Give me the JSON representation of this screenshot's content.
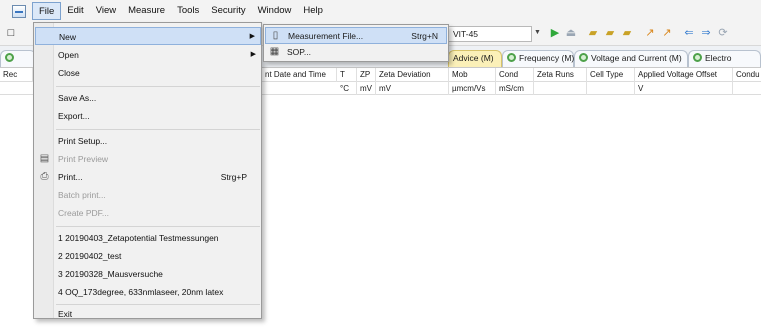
{
  "menubar": {
    "items": [
      "File",
      "Edit",
      "View",
      "Measure",
      "Tools",
      "Security",
      "Window",
      "Help"
    ]
  },
  "toolbar": {
    "instrument_combo": "VIT-45"
  },
  "tabs": [
    {
      "label": "Advice (M)",
      "icon": "advice-icon"
    },
    {
      "label": "Frequency (M)",
      "icon": "frequency-icon"
    },
    {
      "label": "Voltage and Current (M)",
      "icon": "voltage-icon"
    },
    {
      "label": "Electro",
      "icon": "electro-icon"
    }
  ],
  "table": {
    "first_col": "Rec",
    "headers": [
      "nt Date and Time",
      "T",
      "ZP",
      "Zeta Deviation",
      "Mob",
      "Cond",
      "Zeta Runs",
      "Cell Type",
      "Applied Voltage Offset",
      "Condu"
    ],
    "units": [
      "",
      "°C",
      "mV",
      "mV",
      "µmcm/Vs",
      "mS/cm",
      "",
      "",
      "V",
      ""
    ]
  },
  "file_menu": {
    "items": [
      {
        "label": "New",
        "submenu": true,
        "highlight": true
      },
      {
        "label": "Open",
        "submenu": true
      },
      {
        "label": "Close"
      },
      {
        "label": "Save As..."
      },
      {
        "label": "Export..."
      },
      {
        "label": "Print Setup..."
      },
      {
        "label": "Print Preview",
        "disabled": true
      },
      {
        "label": "Print...",
        "shortcut": "Strg+P"
      },
      {
        "label": "Batch print...",
        "disabled": true
      },
      {
        "label": "Create PDF...",
        "disabled": true
      },
      {
        "label": "1 20190403_Zetapotential Testmessungen"
      },
      {
        "label": "2 20190402_test"
      },
      {
        "label": "3 20190328_Mausversuche"
      },
      {
        "label": "4 OQ_173degree, 633nmlaseer, 20nm latex"
      },
      {
        "label": "Exit"
      }
    ]
  },
  "new_submenu": {
    "items": [
      {
        "label": "Measurement File...",
        "shortcut": "Strg+N",
        "icon": "document-icon"
      },
      {
        "label": "SOP...",
        "icon": "sop-icon"
      }
    ]
  }
}
